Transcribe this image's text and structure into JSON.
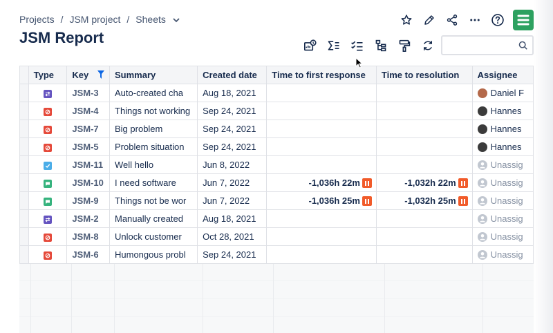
{
  "breadcrumb": {
    "items": [
      "Projects",
      "JSM project",
      "Sheets"
    ],
    "separator": "/"
  },
  "page": {
    "title": "JSM Report"
  },
  "top_actions": [
    "star-icon",
    "edit-icon",
    "share-icon",
    "more-icon",
    "help-icon",
    "app-logo"
  ],
  "toolbar": [
    "report-icon",
    "sum-icon",
    "checklist-icon",
    "hierarchy-icon",
    "paint-roller-icon",
    "refresh-icon"
  ],
  "search": {
    "placeholder": "",
    "value": ""
  },
  "colors": {
    "task": "#6554c0",
    "incident": "#e5493a",
    "story": "#4bade8",
    "service": "#36b37e",
    "pause": "#f15b2a",
    "brand": "#2da160"
  },
  "table": {
    "columns": [
      "Type",
      "Key",
      "Summary",
      "Created date",
      "Time to first response",
      "Time to resolution",
      "Assignee"
    ],
    "rows": [
      {
        "type": "change",
        "key": "JSM-3",
        "summary": "Auto-created cha",
        "created": "Aug 18, 2021",
        "first_response": "",
        "resolution": "",
        "assignee": "Daniel F",
        "assigned": true
      },
      {
        "type": "incident",
        "key": "JSM-4",
        "summary": "Things not working",
        "created": "Sep 24, 2021",
        "first_response": "",
        "resolution": "",
        "assignee": "Hannes",
        "assigned": true
      },
      {
        "type": "incident",
        "key": "JSM-7",
        "summary": "Big problem",
        "created": "Sep 24, 2021",
        "first_response": "",
        "resolution": "",
        "assignee": "Hannes",
        "assigned": true
      },
      {
        "type": "incident",
        "key": "JSM-5",
        "summary": "Problem situation",
        "created": "Sep 24, 2021",
        "first_response": "",
        "resolution": "",
        "assignee": "Hannes",
        "assigned": true
      },
      {
        "type": "task",
        "key": "JSM-11",
        "summary": "Well hello",
        "created": "Jun 8, 2022",
        "first_response": "",
        "resolution": "",
        "assignee": "Unassig",
        "assigned": false
      },
      {
        "type": "service",
        "key": "JSM-10",
        "summary": "I need software",
        "created": "Jun 7, 2022",
        "first_response": "-1,036h 22m",
        "resolution": "-1,032h 22m",
        "assignee": "Unassig",
        "assigned": false
      },
      {
        "type": "service",
        "key": "JSM-9",
        "summary": "Things not be wor",
        "created": "Jun 7, 2022",
        "first_response": "-1,036h 25m",
        "resolution": "-1,032h 25m",
        "assignee": "Unassig",
        "assigned": false
      },
      {
        "type": "change",
        "key": "JSM-2",
        "summary": "Manually created",
        "created": "Aug 18, 2021",
        "first_response": "",
        "resolution": "",
        "assignee": "Unassig",
        "assigned": false
      },
      {
        "type": "incident",
        "key": "JSM-8",
        "summary": "Unlock customer",
        "created": "Oct 28, 2021",
        "first_response": "",
        "resolution": "",
        "assignee": "Unassig",
        "assigned": false
      },
      {
        "type": "incident",
        "key": "JSM-6",
        "summary": "Humongous probl",
        "created": "Sep 24, 2021",
        "first_response": "",
        "resolution": "",
        "assignee": "Unassig",
        "assigned": false
      }
    ]
  }
}
